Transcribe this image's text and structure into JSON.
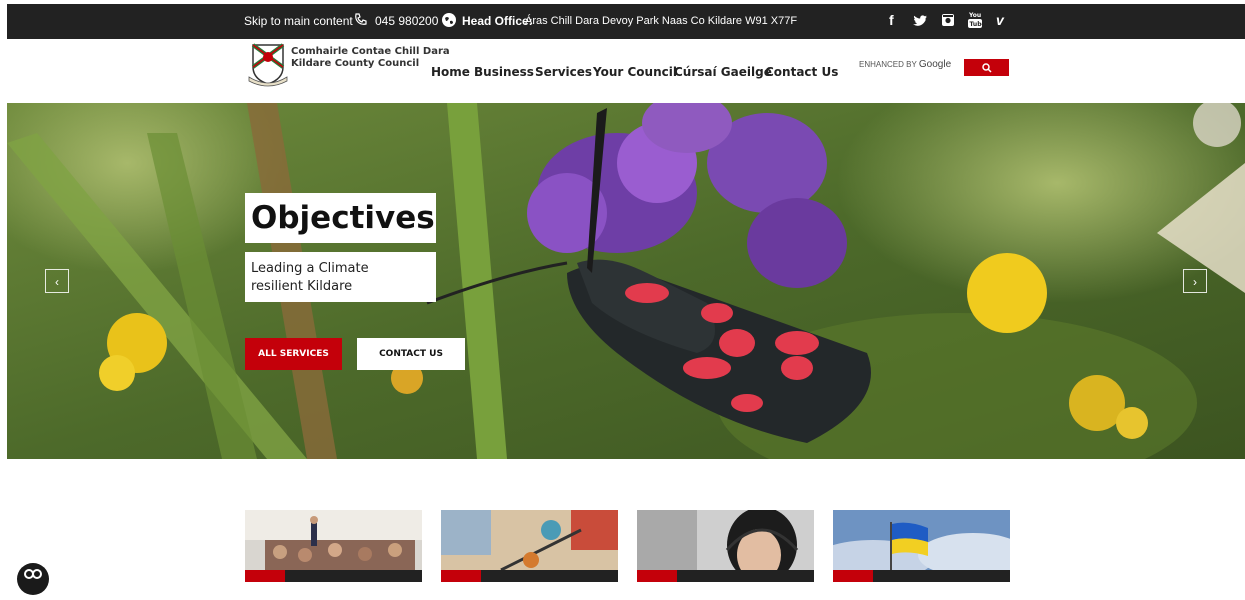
{
  "topbar": {
    "skip_link": "Skip to main content",
    "phone": "045 980200",
    "head_office_label": "Head Office:",
    "head_office_address": "Áras Chill Dara Devoy Park Naas Co Kildare W91 X77F",
    "social_icons": [
      "facebook-icon",
      "twitter-icon",
      "instagram-icon",
      "youtube-icon",
      "vimeo-icon"
    ]
  },
  "header": {
    "logo_line1": "Comhairle Contae Chill Dara",
    "logo_line2": "Kildare County Council",
    "menu": [
      "Home",
      "Business",
      "Services",
      "Your Council",
      "Cúrsaí Gaeilge",
      "Contact Us"
    ],
    "search": {
      "enhanced_by": "ENHANCED BY",
      "google": "Google",
      "button_icon": "search-icon"
    }
  },
  "hero": {
    "title": "Objectives",
    "subtitle_line1": "Leading a Climate",
    "subtitle_line2": "resilient Kildare",
    "button_services": "ALL SERVICES",
    "button_contact": "CONTACT US",
    "prev_icon": "chevron-left-icon",
    "next_icon": "chevron-right-icon"
  },
  "colors": {
    "topbar": "#222222",
    "accent": "#c4000a"
  }
}
